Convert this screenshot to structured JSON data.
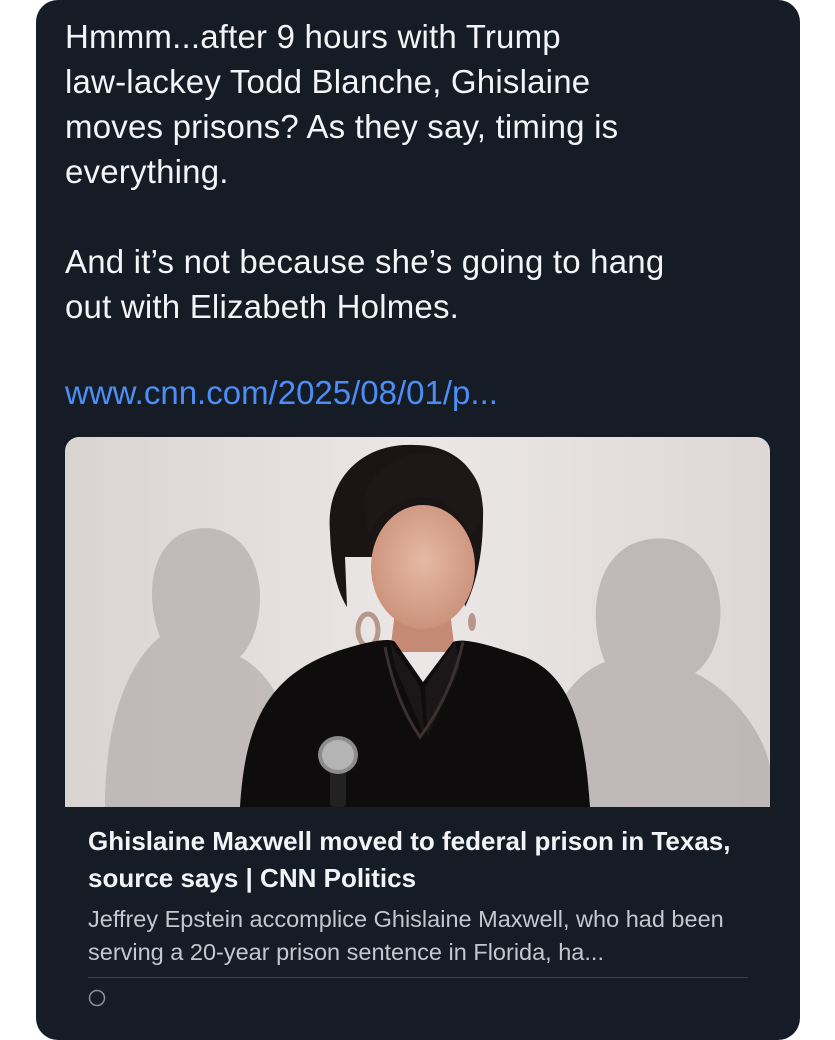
{
  "post": {
    "text": "Hmmm...after 9 hours with Trump\nlaw-lackey Todd Blanche, Ghislaine\nmoves prisons?  As they say, timing is\neverything.\n\nAnd it’s not because she’s going to hang\nout with Elizabeth Holmes.",
    "link": "www.cnn.com/2025/08/01/p..."
  },
  "card": {
    "title": "Ghislaine Maxwell moved to federal prison in Texas, source says | CNN Politics",
    "description": "Jeffrey Epstein accomplice Ghislaine Maxwell, who had been serving a 20-year prison sentence in Florida, ha...",
    "image_icon": "news-photo",
    "footer_icon": "globe-icon"
  },
  "colors": {
    "background": "#161c26",
    "text": "#f2f4f7",
    "link": "#4c8ef5",
    "muted": "#c3c8d0"
  }
}
